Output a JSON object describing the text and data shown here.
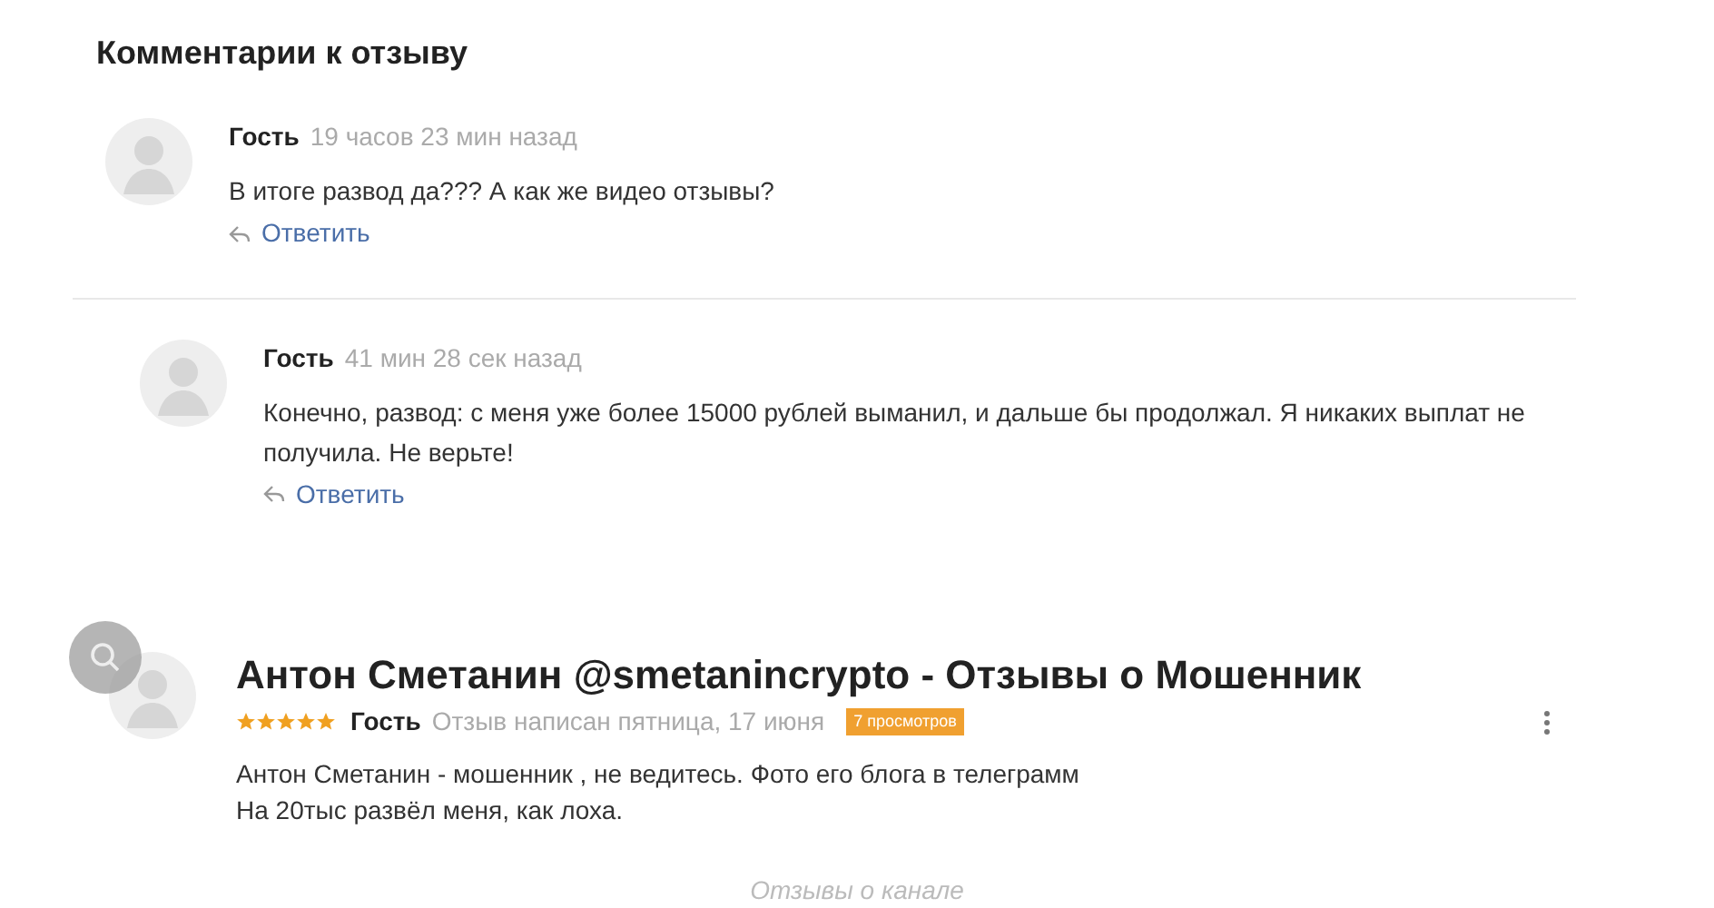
{
  "heading": "Комментарии к отзыву",
  "comments": [
    {
      "author": "Гость",
      "time": "19 часов 23 мин назад",
      "text": "В итоге развод да??? А как же видео отзывы?",
      "reply": "Ответить",
      "children": [
        {
          "author": "Гость",
          "time": "41 мин 28 сек назад",
          "text": "Конечно, развод: с меня уже более 15000 рублей выманил, и дальше бы продолжал. Я никаких выплат не получила. Не верьте!",
          "reply": "Ответить"
        }
      ]
    }
  ],
  "review": {
    "title": "Антон Сметанин @smetanincrypto - Отзывы о Мошенник",
    "stars": 5,
    "author": "Гость",
    "date": "Отзыв написан пятница, 17 июня",
    "views": "7 просмотров",
    "lines": [
      "Антон Сметанин - мошенник , не ведитесь. Фото его блога в телеграмм",
      "На 20тыс развёл меня, как лоха."
    ]
  },
  "footer": "Отзывы о канале"
}
